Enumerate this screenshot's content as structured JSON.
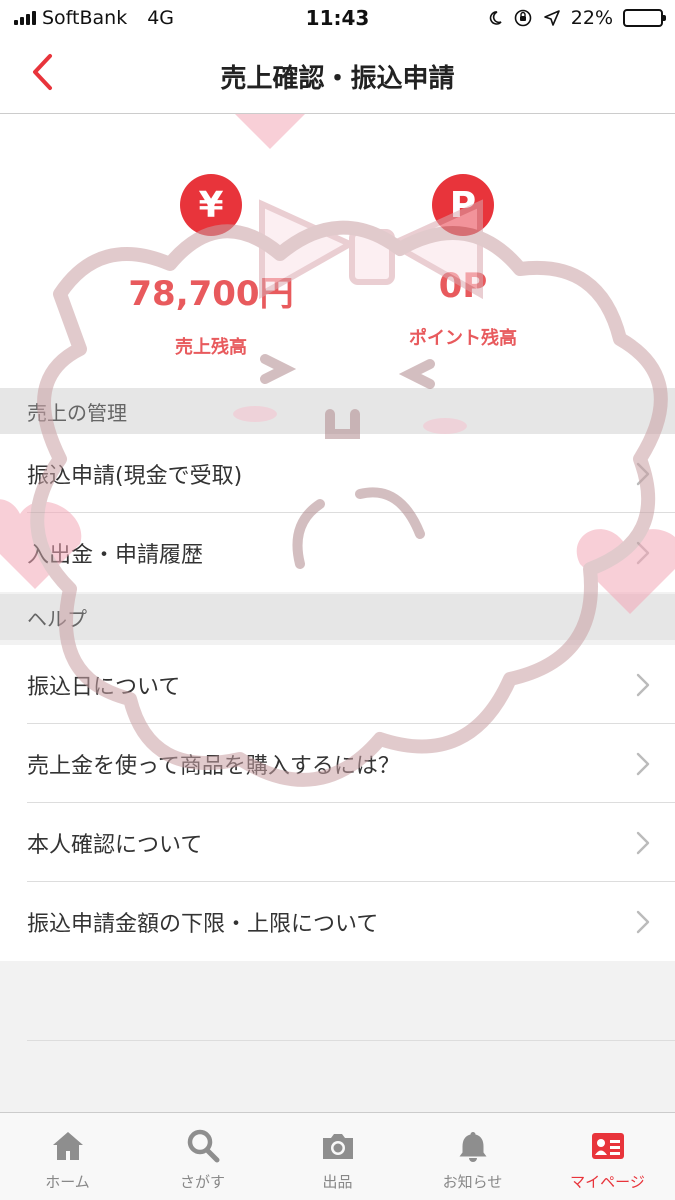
{
  "status_bar": {
    "carrier": "SoftBank",
    "network": "4G",
    "time": "11:43",
    "battery": "22%",
    "battery_level": 0.22
  },
  "nav": {
    "title": "売上確認・振込申請",
    "back_icon": "chevron-left-icon"
  },
  "summary": {
    "sales": {
      "icon": "¥",
      "amount": "78,700円",
      "label": "売上残高"
    },
    "points": {
      "icon": "P",
      "amount": "0P",
      "label": "ポイント残高"
    }
  },
  "sections": {
    "sales_management": {
      "title": "売上の管理",
      "items": [
        {
          "label": "振込申請(現金で受取)"
        },
        {
          "label": "入出金・申請履歴"
        }
      ]
    },
    "help": {
      "title": "ヘルプ",
      "items": [
        {
          "label": "振込日について"
        },
        {
          "label": "売上金を使って商品を購入するには？"
        },
        {
          "label": "本人確認について"
        },
        {
          "label": "振込申請金額の下限・上限について"
        }
      ]
    }
  },
  "tab_bar": {
    "tabs": [
      {
        "label": "ホーム",
        "icon": "home-icon",
        "active": false
      },
      {
        "label": "さがす",
        "icon": "search-icon",
        "active": false
      },
      {
        "label": "出品",
        "icon": "camera-icon",
        "active": false
      },
      {
        "label": "お知らせ",
        "icon": "bell-icon",
        "active": false
      },
      {
        "label": "マイページ",
        "icon": "profile-card-icon",
        "active": true
      }
    ]
  },
  "colors": {
    "accent": "#e8343b",
    "amount_text": "#e85a5d",
    "section_bg": "#e6e6e6",
    "inactive_icon": "#8e8e8e"
  }
}
